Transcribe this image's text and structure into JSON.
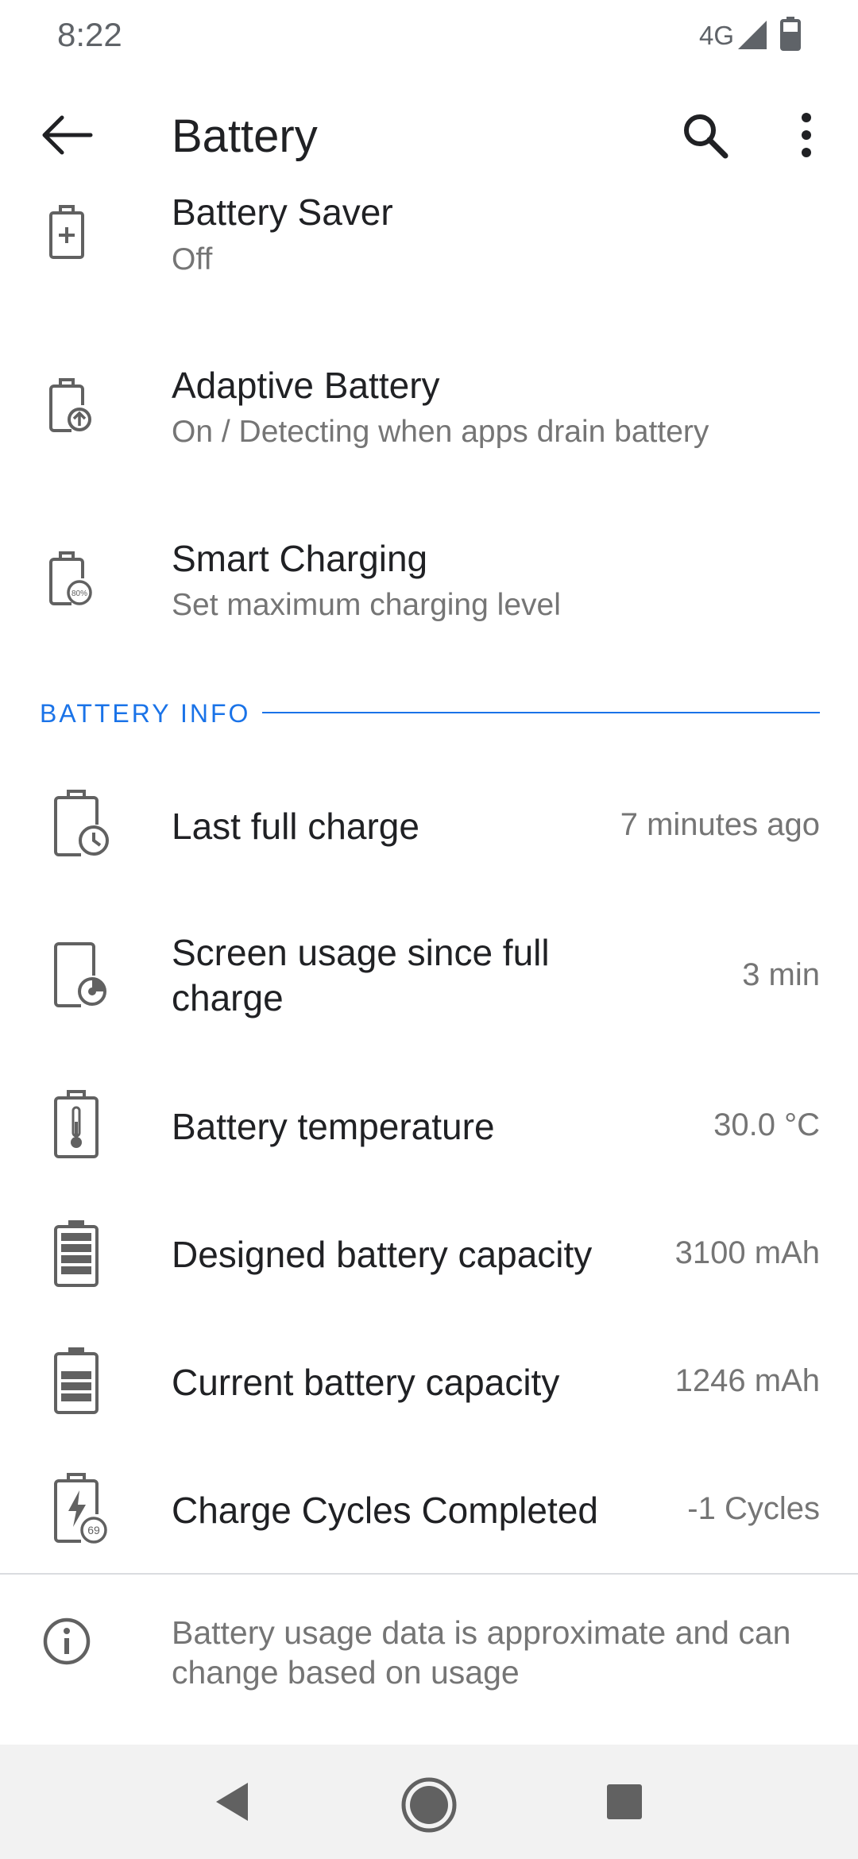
{
  "status_bar": {
    "time": "8:22",
    "network": "4G"
  },
  "app_bar": {
    "title": "Battery",
    "back_icon": "arrow-left-icon",
    "search_icon": "search-icon",
    "more_icon": "more-vert-icon"
  },
  "settings": [
    {
      "title": "Battery Saver",
      "subtitle": "Off",
      "icon": "battery-plus-icon"
    },
    {
      "title": "Adaptive Battery",
      "subtitle": "On / Detecting when apps drain battery",
      "icon": "battery-upload-icon"
    },
    {
      "title": "Smart Charging",
      "subtitle": "Set maximum charging level",
      "icon": "battery-80-icon",
      "badge": "80%"
    }
  ],
  "section": {
    "header": "BATTERY INFO"
  },
  "info_rows": [
    {
      "title": "Last full charge",
      "value": "7 minutes ago",
      "icon": "battery-clock-icon"
    },
    {
      "title_line1": "Screen usage since full",
      "title_line2": "charge",
      "value": "3 min",
      "icon": "phone-usage-icon"
    },
    {
      "title": "Battery temperature",
      "value": "30.0 °C",
      "icon": "battery-thermometer-icon"
    },
    {
      "title": "Designed battery capacity",
      "value": "3100 mAh",
      "icon": "battery-full-icon"
    },
    {
      "title": "Current battery capacity",
      "value": "1246 mAh",
      "icon": "battery-level-icon"
    },
    {
      "title": "Charge Cycles Completed",
      "value": "-1 Cycles",
      "icon": "battery-cycles-icon",
      "badge": "69"
    }
  ],
  "footer": {
    "text": "Battery usage data is approximate and can change based on usage",
    "icon": "info-icon"
  },
  "nav_bar": {
    "back": "nav-back-icon",
    "home": "nav-home-icon",
    "recents": "nav-recents-icon"
  },
  "colors": {
    "accent": "#1a73e8",
    "text_primary": "#202124",
    "text_secondary": "#757575",
    "icon": "#616161"
  }
}
